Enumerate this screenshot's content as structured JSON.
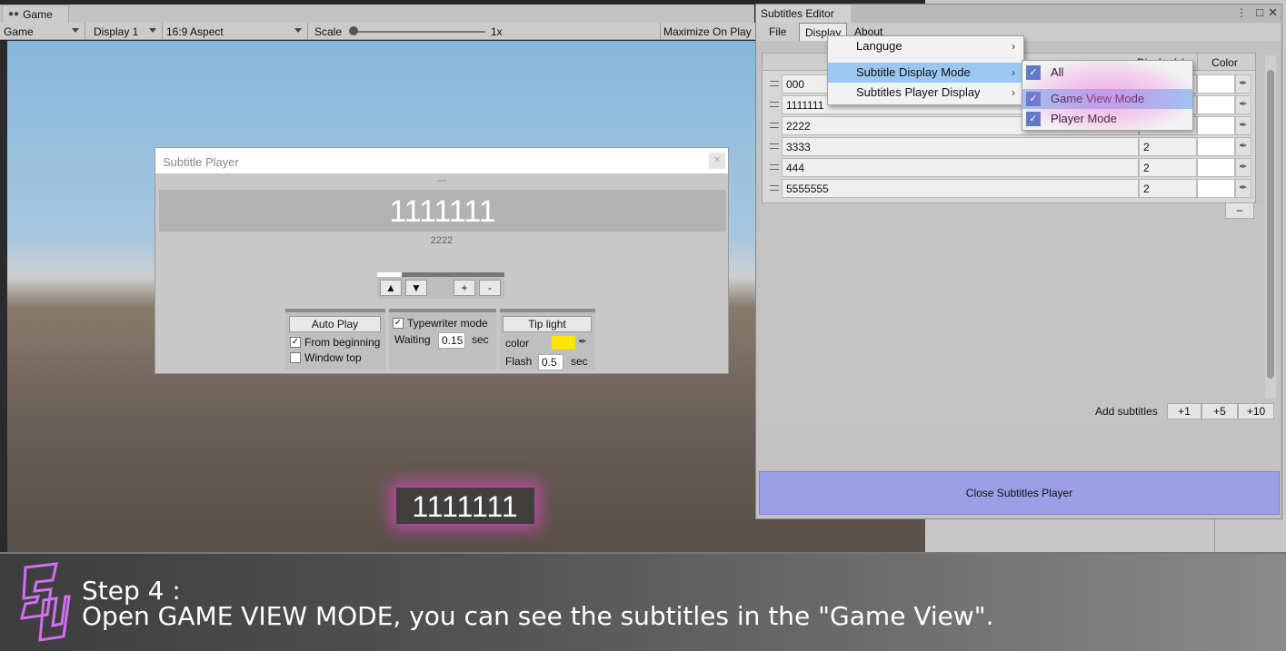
{
  "game": {
    "tab_label": "Game",
    "mode_dropdown": "Game",
    "display_dropdown": "Display 1",
    "aspect_dropdown": "16:9 Aspect",
    "scale_label": "Scale",
    "scale_value": "1x",
    "maximize_label": "Maximize On Play"
  },
  "subtitle_player": {
    "title": "Subtitle Player",
    "prev_text": "---",
    "current_text": "1111111",
    "next_text": "2222",
    "progress_fraction": 0.19,
    "up_button": "▲",
    "down_button": "▼",
    "plus_button": "+",
    "minus_button": "-",
    "auto_play_button": "Auto Play",
    "from_beginning_label": "From beginning",
    "window_top_label": "Window top",
    "typewriter_label": "Typewriter mode",
    "waiting_label": "Waiting",
    "waiting_value": "0.15",
    "waiting_unit": "sec",
    "tip_light_button": "Tip light",
    "color_label": "color",
    "tip_color": "#ffe600",
    "flash_label": "Flash",
    "flash_value": "0.5",
    "flash_unit": "sec"
  },
  "in_game_subtitle": "1111111",
  "editor": {
    "title": "Subtitles Editor",
    "menus": [
      "File",
      "Display",
      "About"
    ],
    "column_display": "Display(s)",
    "column_color": "Color",
    "rows": [
      {
        "text": "000",
        "display": ""
      },
      {
        "text": "1111111",
        "display": ""
      },
      {
        "text": "2222",
        "display": ""
      },
      {
        "text": "3333",
        "display": "2"
      },
      {
        "text": "444",
        "display": "2"
      },
      {
        "text": "5555555",
        "display": "2"
      }
    ],
    "remove_button": "–",
    "add_subtitles_label": "Add subtitles",
    "add_buttons": [
      "+1",
      "+5",
      "+10"
    ],
    "close_player_button": "Close Subtitles Player"
  },
  "display_menu": {
    "items": [
      "Languge",
      "Subtitle Display Mode",
      "Subtitles Player Display"
    ],
    "submenu": [
      "All",
      "Game View Mode",
      "Player Mode"
    ]
  },
  "banner": {
    "step_title": "Step 4 :",
    "step_desc": "Open GAME VIEW MODE, you can see the subtitles in the \"Game View\".",
    "logo_color": "#d070f0"
  }
}
